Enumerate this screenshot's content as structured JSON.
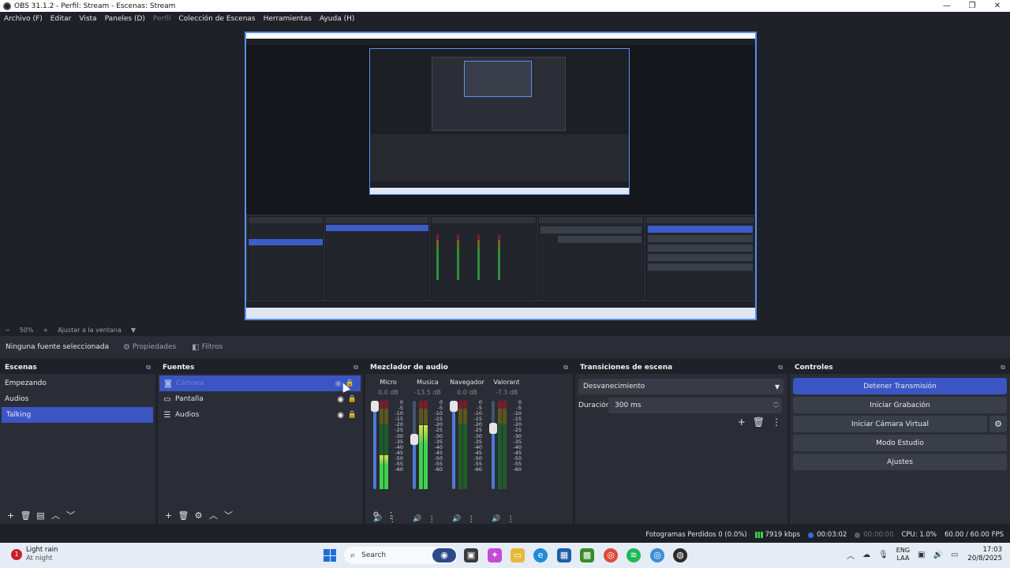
{
  "window": {
    "title": "OBS 31.1.2 - Perfil: Stream - Escenas: Stream",
    "controls": [
      "—",
      "❐",
      "✕"
    ]
  },
  "menu": [
    "Archivo (F)",
    "Editar",
    "Vista",
    "Paneles (D)",
    "Perfil",
    "Colección de Escenas",
    "Herramientas",
    "Ayuda (H)"
  ],
  "zoom": {
    "minus": "−",
    "value": "50%",
    "plus": "+",
    "fit": "Ajustar a la ventana",
    "caret": "▼"
  },
  "source_toolbar": {
    "no_source": "Ninguna fuente seleccionada",
    "properties": "Propiedades",
    "filters": "Filtros"
  },
  "scenes": {
    "title": "Escenas",
    "items": [
      {
        "label": "Empezando",
        "selected": false
      },
      {
        "label": "Audios",
        "selected": false
      },
      {
        "label": "Talking",
        "selected": true
      }
    ]
  },
  "sources": {
    "title": "Fuentes",
    "items": [
      {
        "label": "Cámara",
        "icon": "camera-icon",
        "glyph": "📷",
        "selected": true
      },
      {
        "label": "Pantalla",
        "icon": "monitor-icon",
        "glyph": "▭",
        "selected": false
      },
      {
        "label": "Audios",
        "icon": "list-icon",
        "glyph": "☰",
        "selected": false
      }
    ]
  },
  "mixer": {
    "title": "Mezclador de audio",
    "scale": [
      "0",
      "-5",
      "-10",
      "-15",
      "-20",
      "-25",
      "-30",
      "-35",
      "-40",
      "-45",
      "-50",
      "-55",
      "-60"
    ],
    "channels": [
      {
        "name": "Micro",
        "db": "0.0 dB",
        "fader": 1.0,
        "level": 0.38
      },
      {
        "name": "Musica",
        "db": "-13.5 dB",
        "fader": 0.58,
        "level": 0.72
      },
      {
        "name": "Navegador",
        "db": "0.0 dB",
        "fader": 1.0,
        "level": 0.0
      },
      {
        "name": "Valorant",
        "db": "-7.3 dB",
        "fader": 0.72,
        "level": 0.0
      }
    ]
  },
  "transitions": {
    "title": "Transiciones de escena",
    "selected": "Desvanecimiento",
    "duration_label": "Duración",
    "duration_value": "300 ms"
  },
  "controls": {
    "title": "Controles",
    "stop_stream": "Detener Transmisión",
    "start_recording": "Iniciar Grabación",
    "start_virtual_cam": "Iniciar Cámara Virtual",
    "studio_mode": "Modo Estudio",
    "settings": "Ajustes"
  },
  "status": {
    "dropped_frames": "Fotogramas Perdidos 0 (0.0%)",
    "bitrate": "7919 kbps",
    "stream_time": "00:03:02",
    "rec_time": "00:00:00",
    "cpu": "CPU: 1.0%",
    "fps": "60.00 / 60.00 FPS",
    "colors": {
      "live": "#2f6fe0",
      "rec": "#5a5e66",
      "signal": "#3fd14e"
    }
  },
  "taskbar": {
    "weather_title": "Light rain",
    "weather_sub": "At night",
    "search_placeholder": "Search",
    "lang_top": "ENG",
    "lang_bottom": "LAA",
    "time": "17:03",
    "date": "20/8/2025"
  }
}
